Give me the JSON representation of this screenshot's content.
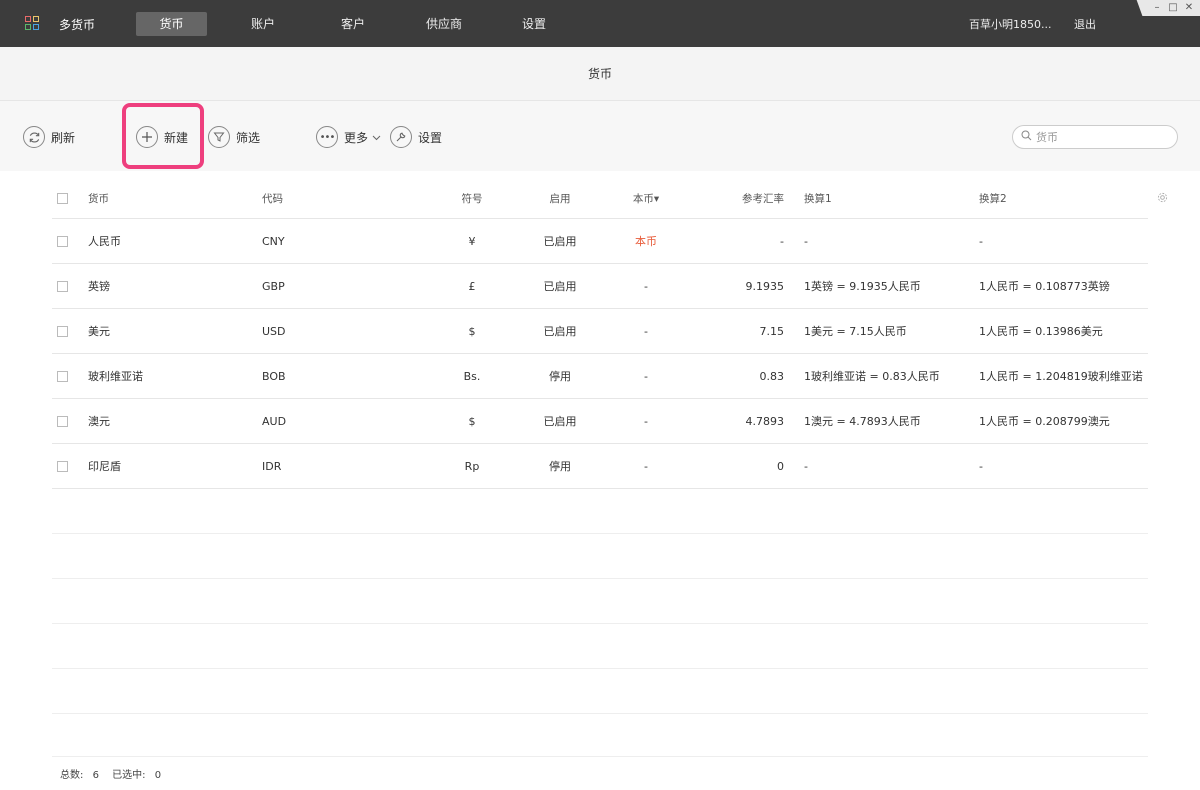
{
  "app": {
    "title": "多货币"
  },
  "nav": {
    "items": [
      {
        "label": "货币",
        "active": true
      },
      {
        "label": "账户"
      },
      {
        "label": "客户"
      },
      {
        "label": "供应商"
      },
      {
        "label": "设置"
      }
    ],
    "user": "百草小明1850...",
    "logout": "退出"
  },
  "window_controls": {
    "minimize": "–",
    "maximize": "□",
    "close": "✕"
  },
  "page": {
    "title": "货币"
  },
  "toolbar": {
    "refresh": "刷新",
    "new": "新建",
    "filter": "筛选",
    "more": "更多",
    "settings": "设置",
    "search_placeholder": "货币"
  },
  "table": {
    "headers": {
      "name": "货币",
      "code": "代码",
      "symbol": "符号",
      "enabled": "启用",
      "base": "本币▾",
      "rate": "参考汇率",
      "conv1": "换算1",
      "conv2": "换算2"
    },
    "rows": [
      {
        "name": "人民币",
        "code": "CNY",
        "symbol": "¥",
        "enabled": "已启用",
        "base": "本币",
        "rate": "-",
        "conv1": "-",
        "conv2": "-"
      },
      {
        "name": "英镑",
        "code": "GBP",
        "symbol": "£",
        "enabled": "已启用",
        "base": "-",
        "rate": "9.1935",
        "conv1": "1英镑 = 9.1935人民币",
        "conv2": "1人民币 = 0.108773英镑"
      },
      {
        "name": "美元",
        "code": "USD",
        "symbol": "$",
        "enabled": "已启用",
        "base": "-",
        "rate": "7.15",
        "conv1": "1美元 = 7.15人民币",
        "conv2": "1人民币 = 0.13986美元"
      },
      {
        "name": "玻利维亚诺",
        "code": "BOB",
        "symbol": "Bs.",
        "enabled": "停用",
        "base": "-",
        "rate": "0.83",
        "conv1": "1玻利维亚诺 = 0.83人民币",
        "conv2": "1人民币 = 1.204819玻利维亚诺"
      },
      {
        "name": "澳元",
        "code": "AUD",
        "symbol": "$",
        "enabled": "已启用",
        "base": "-",
        "rate": "4.7893",
        "conv1": "1澳元 = 4.7893人民币",
        "conv2": "1人民币 = 0.208799澳元"
      },
      {
        "name": "印尼盾",
        "code": "IDR",
        "symbol": "Rp",
        "enabled": "停用",
        "base": "-",
        "rate": "0",
        "conv1": "-",
        "conv2": "-"
      }
    ]
  },
  "footer": {
    "total_label": "总数:",
    "total": "6",
    "selected_label": "已选中:",
    "selected": "0"
  },
  "colors": {
    "nav_bg": "#3c3c3c",
    "highlight": "#ee3f7e",
    "base_currency": "#e85c3a"
  }
}
